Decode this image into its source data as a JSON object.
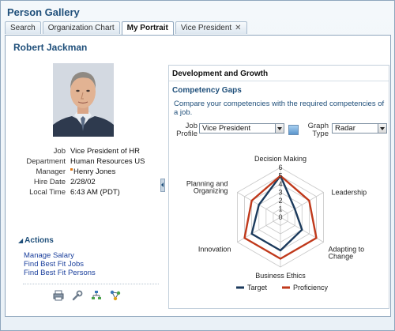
{
  "app": {
    "title": "Person Gallery",
    "tabs": [
      {
        "label": "Search"
      },
      {
        "label": "Organization Chart"
      },
      {
        "label": "My Portrait"
      },
      {
        "label": "Vice President"
      }
    ],
    "tab_close_glyph": "✕"
  },
  "person": {
    "name": "Robert Jackman",
    "details": [
      {
        "label": "Job",
        "value": "Vice President of HR"
      },
      {
        "label": "Department",
        "value": "Human Resources US"
      },
      {
        "label": "Manager",
        "value": "Henry Jones"
      },
      {
        "label": "Hire Date",
        "value": "2/28/02"
      },
      {
        "label": "Local Time",
        "value": "6:43 AM (PDT)"
      }
    ],
    "presence_color": "#e07a1a"
  },
  "actions": {
    "header": "Actions",
    "links": [
      "Manage Salary",
      "Find Best Fit Jobs",
      "Find Best Fit Persons"
    ],
    "toolbar_icons": [
      "printer-icon",
      "wrench-icon",
      "org-chart-icon",
      "network-icon"
    ]
  },
  "development": {
    "panel_title": "Development and Growth",
    "section_title": "Competency Gaps",
    "description": "Compare your competencies with the required competencies of a job.",
    "job_profile": {
      "label_line1": "Job",
      "label_line2": "Profile",
      "selected": "Vice President"
    },
    "graph_type": {
      "label_line1": "Graph",
      "label_line2": "Type",
      "selected": "Radar"
    }
  },
  "chart_data": {
    "type": "radar",
    "categories": [
      "Decision Making",
      "Leadership",
      "Adapting to Change",
      "Business Ethics",
      "Innovation",
      "Planning and Organizing"
    ],
    "tick_labels": [
      "0",
      "1",
      "2",
      "3",
      "4",
      "5",
      "6"
    ],
    "rmax": 6,
    "series": [
      {
        "name": "Target",
        "color": "#1b3a5c",
        "values": [
          5,
          2,
          3,
          4,
          4,
          3
        ]
      },
      {
        "name": "Proficiency",
        "color": "#c0391b",
        "values": [
          5,
          4,
          5,
          5,
          5,
          4
        ]
      }
    ],
    "legend_position": "bottom"
  },
  "colors": {
    "accent": "#1f4f7a",
    "link": "#1a3f9c",
    "border": "#8fa6bd"
  }
}
